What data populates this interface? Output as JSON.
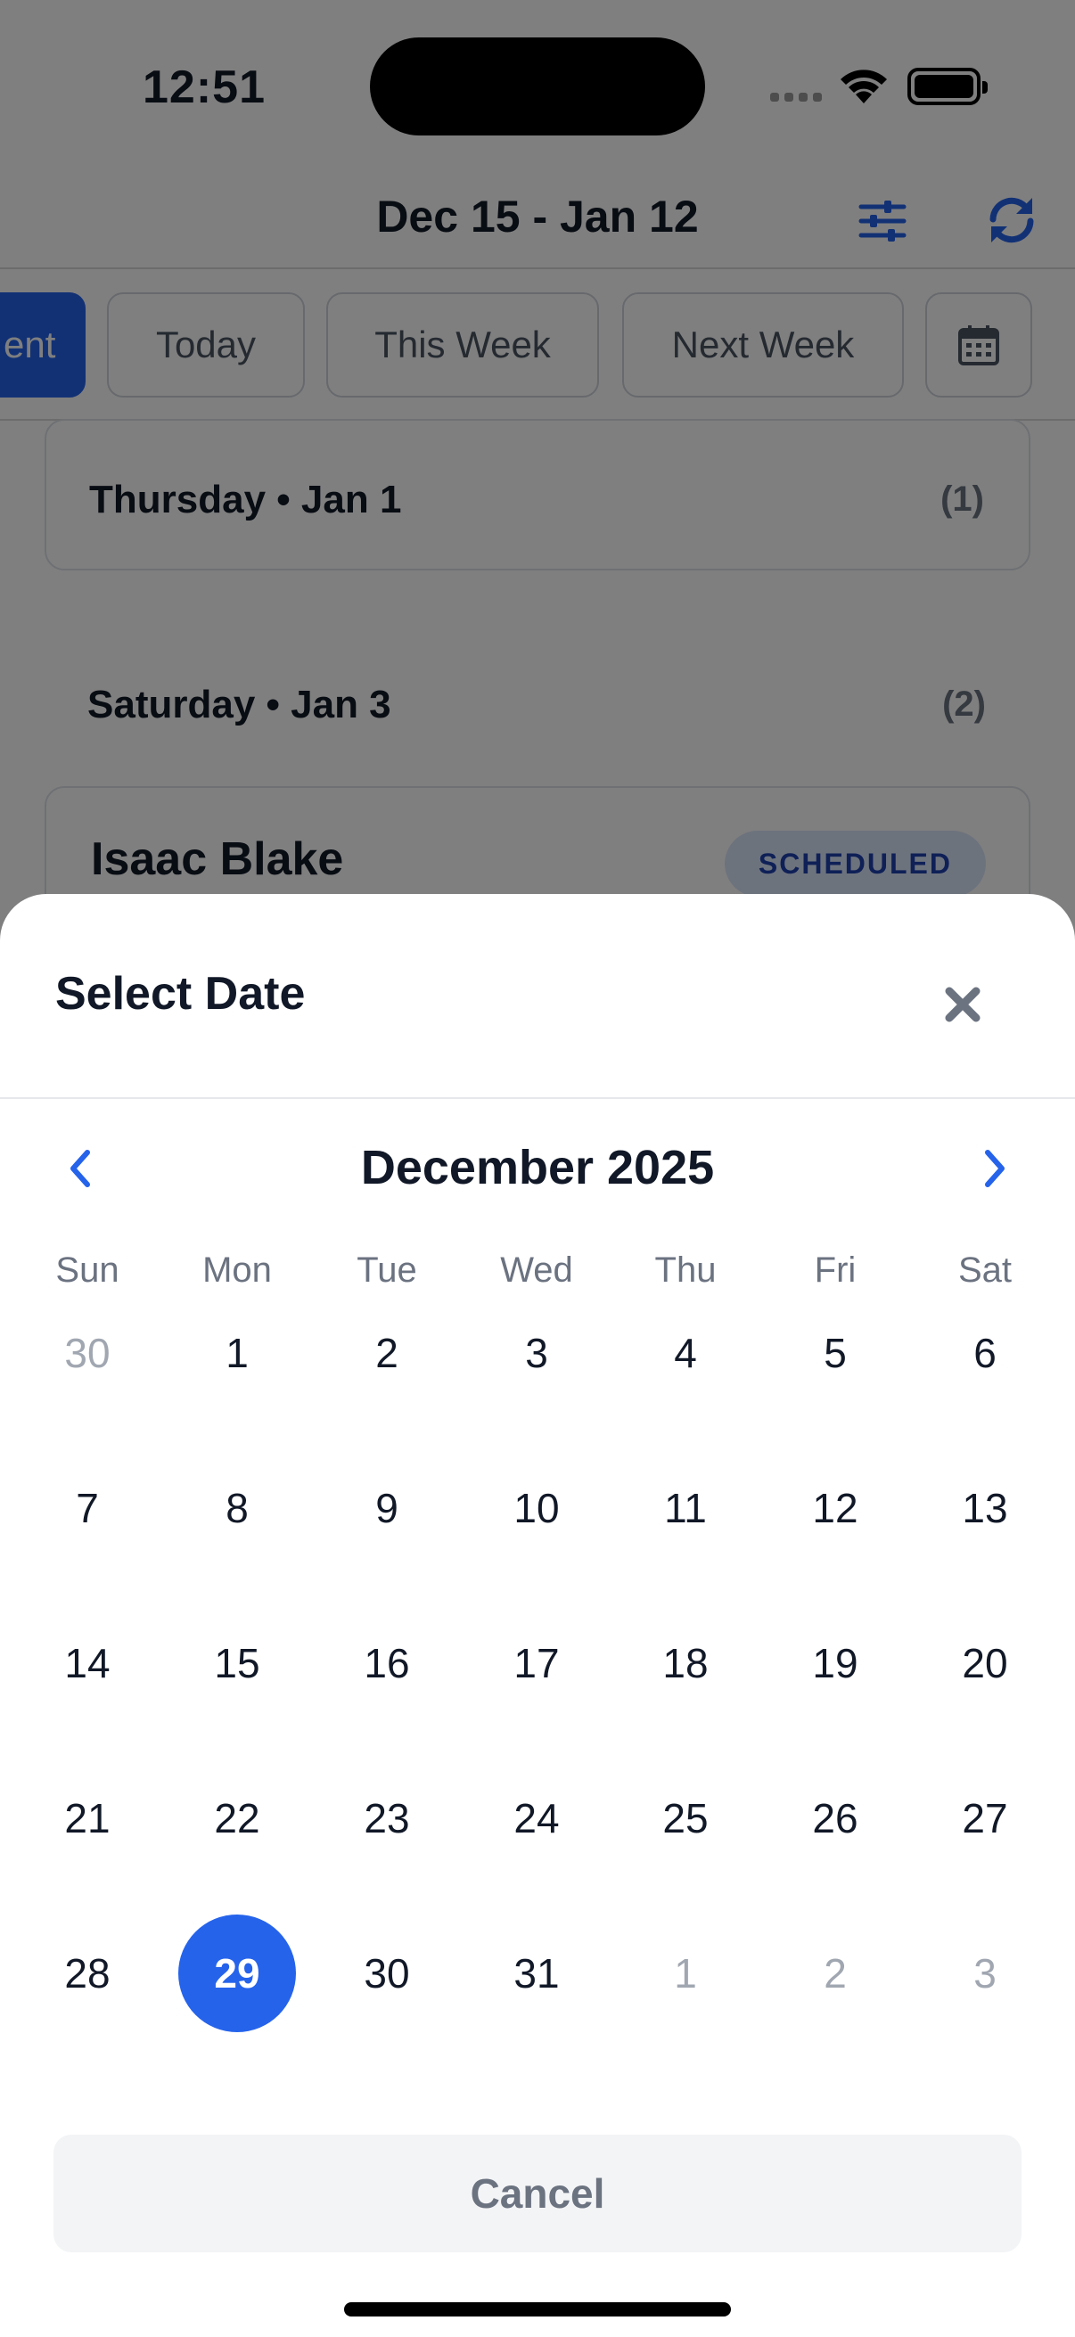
{
  "status_bar": {
    "time": "12:51"
  },
  "nav": {
    "title": "Dec 15 - Jan 12",
    "filter_icon": "sliders-icon",
    "refresh_icon": "refresh-icon"
  },
  "chips": [
    {
      "label": "ent",
      "active": true
    },
    {
      "label": "Today",
      "active": false
    },
    {
      "label": "This Week",
      "active": false
    },
    {
      "label": "Next Week",
      "active": false
    }
  ],
  "list": {
    "days": [
      {
        "title": "Thursday • Jan 1",
        "count": "(1)"
      },
      {
        "title": "Saturday • Jan 3",
        "count": "(2)"
      }
    ],
    "appointment": {
      "name": "Isaac Blake",
      "status": "SCHEDULED"
    }
  },
  "sheet": {
    "title": "Select Date",
    "month": "December 2025",
    "weekdays": [
      "Sun",
      "Mon",
      "Tue",
      "Wed",
      "Thu",
      "Fri",
      "Sat"
    ],
    "weeks": [
      [
        {
          "d": "30",
          "m": true
        },
        {
          "d": "1"
        },
        {
          "d": "2"
        },
        {
          "d": "3"
        },
        {
          "d": "4"
        },
        {
          "d": "5"
        },
        {
          "d": "6"
        }
      ],
      [
        {
          "d": "7"
        },
        {
          "d": "8"
        },
        {
          "d": "9"
        },
        {
          "d": "10"
        },
        {
          "d": "11"
        },
        {
          "d": "12"
        },
        {
          "d": "13"
        }
      ],
      [
        {
          "d": "14"
        },
        {
          "d": "15"
        },
        {
          "d": "16"
        },
        {
          "d": "17"
        },
        {
          "d": "18"
        },
        {
          "d": "19"
        },
        {
          "d": "20"
        }
      ],
      [
        {
          "d": "21"
        },
        {
          "d": "22"
        },
        {
          "d": "23"
        },
        {
          "d": "24"
        },
        {
          "d": "25"
        },
        {
          "d": "26"
        },
        {
          "d": "27"
        }
      ],
      [
        {
          "d": "28"
        },
        {
          "d": "29",
          "s": true
        },
        {
          "d": "30"
        },
        {
          "d": "31"
        },
        {
          "d": "1",
          "m": true
        },
        {
          "d": "2",
          "m": true
        },
        {
          "d": "3",
          "m": true
        }
      ]
    ],
    "selected_day": "29",
    "cancel_label": "Cancel"
  },
  "colors": {
    "accent": "#2563eb",
    "muted": "#a1a7b1",
    "badge_bg": "#dbe6fb"
  }
}
